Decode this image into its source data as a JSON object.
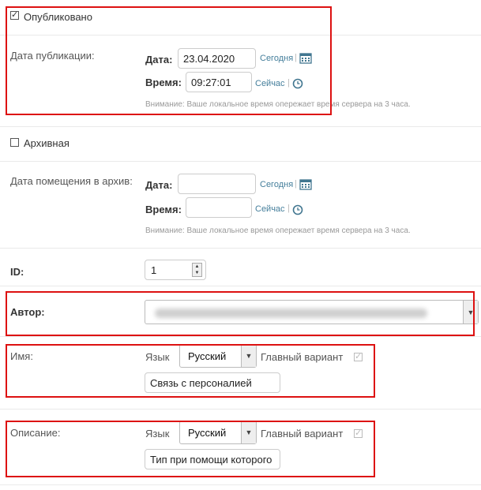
{
  "published": {
    "label": "Опубликовано",
    "checked": true
  },
  "pub_date": {
    "label": "Дата публикации:",
    "date_label": "Дата:",
    "date_value": "23.04.2020",
    "today_link": "Сегодня",
    "time_label": "Время:",
    "time_value": "09:27:01",
    "now_link": "Сейчас",
    "help": "Внимание: Ваше локальное время опережает время сервера на 3 часа."
  },
  "archived": {
    "label": "Архивная",
    "checked": false
  },
  "archive_date": {
    "label": "Дата помещения в архив:",
    "date_label": "Дата:",
    "date_value": "",
    "today_link": "Сегодня",
    "time_label": "Время:",
    "time_value": "",
    "now_link": "Сейчас",
    "help": "Внимание: Ваше локальное время опережает время сервера на 3 часа."
  },
  "id_field": {
    "label": "ID:",
    "value": "1"
  },
  "author": {
    "label": "Автор:"
  },
  "name_field": {
    "label": "Имя:",
    "lang_label": "Язык",
    "lang_value": "Русский",
    "main_variant_label": "Главный вариант",
    "value": "Связь с персоналией"
  },
  "description_field": {
    "label": "Описание:",
    "lang_label": "Язык",
    "lang_value": "Русский",
    "main_variant_label": "Главный вариант",
    "value": "Тип при помощи которого"
  },
  "colors": {
    "highlight": "#dd1111",
    "link": "#447e9b",
    "icon": "#417690"
  }
}
